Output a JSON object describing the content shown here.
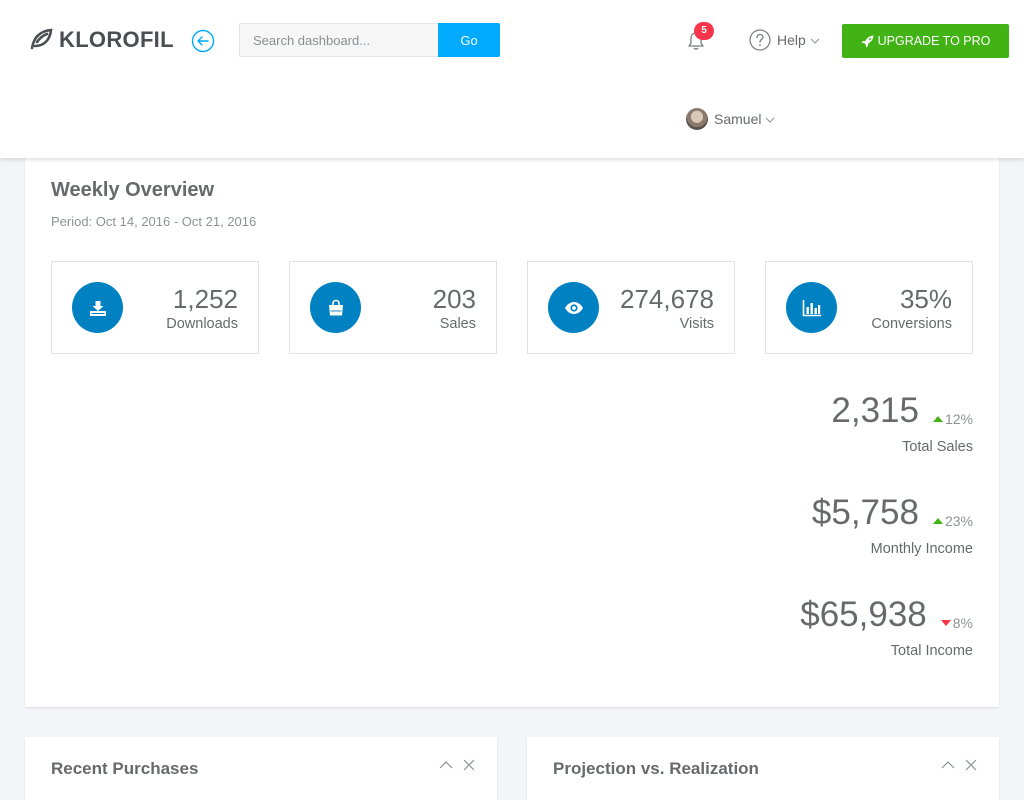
{
  "brand": {
    "name": "KLOROFIL"
  },
  "search": {
    "placeholder": "Search dashboard...",
    "button_label": "Go"
  },
  "notifications": {
    "count": "5"
  },
  "help": {
    "label": "Help"
  },
  "upgrade": {
    "label": "UPGRADE TO PRO"
  },
  "user": {
    "name": "Samuel"
  },
  "overview": {
    "title": "Weekly Overview",
    "period": "Period: Oct 14, 2016 - Oct 21, 2016",
    "metrics": [
      {
        "value": "1,252",
        "label": "Downloads",
        "icon": "download-icon"
      },
      {
        "value": "203",
        "label": "Sales",
        "icon": "shopping-bag-icon"
      },
      {
        "value": "274,678",
        "label": "Visits",
        "icon": "eye-icon"
      },
      {
        "value": "35%",
        "label": "Conversions",
        "icon": "bar-chart-icon"
      }
    ],
    "stats": [
      {
        "value": "2,315",
        "change": "12%",
        "direction": "up",
        "label": "Total Sales"
      },
      {
        "value": "$5,758",
        "change": "23%",
        "direction": "up",
        "label": "Monthly Income"
      },
      {
        "value": "$65,938",
        "change": "8%",
        "direction": "down",
        "label": "Total Income"
      }
    ]
  },
  "panels": {
    "recent_purchases": {
      "title": "Recent Purchases"
    },
    "projection": {
      "title": "Projection vs. Realization"
    }
  },
  "colors": {
    "accent": "#00aaff",
    "icon_circle": "#0081c2",
    "upgrade": "#41b314",
    "badge": "#f9354c",
    "up": "#41b314",
    "down": "#f9354c"
  }
}
